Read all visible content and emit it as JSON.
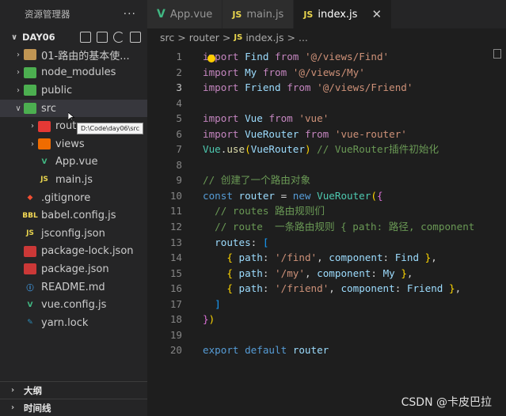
{
  "explorer": {
    "title": "资源管理器",
    "more": "···",
    "project": "DAY06",
    "project_chevron": "∨",
    "items": [
      {
        "label": "01-路由的基本使...",
        "arrow": "›",
        "type": "folder"
      },
      {
        "label": "node_modules",
        "arrow": "›",
        "type": "folder-green"
      },
      {
        "label": "public",
        "arrow": "›",
        "type": "folder-green"
      },
      {
        "label": "src",
        "arrow": "∨",
        "type": "folder-green"
      },
      {
        "label": "router",
        "arrow": "›",
        "type": "folder-red"
      },
      {
        "label": "views",
        "arrow": "›",
        "type": "folder-orange"
      },
      {
        "label": "App.vue",
        "arrow": "",
        "type": "vue"
      },
      {
        "label": "main.js",
        "arrow": "",
        "type": "js"
      },
      {
        "label": ".gitignore",
        "arrow": "",
        "type": "git"
      },
      {
        "label": "babel.config.js",
        "arrow": "",
        "type": "babel"
      },
      {
        "label": "jsconfig.json",
        "arrow": "",
        "type": "js"
      },
      {
        "label": "package-lock.json",
        "arrow": "",
        "type": "npm"
      },
      {
        "label": "package.json",
        "arrow": "",
        "type": "npm"
      },
      {
        "label": "README.md",
        "arrow": "",
        "type": "md"
      },
      {
        "label": "vue.config.js",
        "arrow": "",
        "type": "vue"
      },
      {
        "label": "yarn.lock",
        "arrow": "",
        "type": "yarn"
      }
    ],
    "tooltip": "D:\\Code\\day06\\src",
    "outline": "大纲",
    "timeline": "时间线"
  },
  "tabs": [
    {
      "label": "App.vue",
      "icon": "V",
      "kind": "vue"
    },
    {
      "label": "main.js",
      "icon": "JS",
      "kind": "js"
    },
    {
      "label": "index.js",
      "icon": "JS",
      "kind": "js",
      "active": true,
      "close": "✕"
    }
  ],
  "breadcrumb": [
    "src",
    "router",
    "index.js",
    "..."
  ],
  "breadcrumb_sep": ">",
  "code_lines": [
    {
      "n": "1",
      "tokens": [
        [
          "kw",
          "import"
        ],
        [
          "pl",
          " "
        ],
        [
          "var",
          "Find"
        ],
        [
          "pl",
          " "
        ],
        [
          "kw",
          "from"
        ],
        [
          "pl",
          " "
        ],
        [
          "str",
          "'@/views/Find'"
        ]
      ]
    },
    {
      "n": "2",
      "tokens": [
        [
          "kw",
          "import"
        ],
        [
          "pl",
          " "
        ],
        [
          "var",
          "My"
        ],
        [
          "pl",
          " "
        ],
        [
          "kw",
          "from"
        ],
        [
          "pl",
          " "
        ],
        [
          "str",
          "'@/views/My'"
        ]
      ]
    },
    {
      "n": "3",
      "tokens": [
        [
          "kw",
          "import"
        ],
        [
          "pl",
          " "
        ],
        [
          "var",
          "Friend"
        ],
        [
          "pl",
          " "
        ],
        [
          "kw",
          "from"
        ],
        [
          "pl",
          " "
        ],
        [
          "str",
          "'@/views/Friend'"
        ]
      ]
    },
    {
      "n": "4",
      "tokens": []
    },
    {
      "n": "5",
      "tokens": [
        [
          "kw",
          "import"
        ],
        [
          "pl",
          " "
        ],
        [
          "var",
          "Vue"
        ],
        [
          "pl",
          " "
        ],
        [
          "kw",
          "from"
        ],
        [
          "pl",
          " "
        ],
        [
          "str",
          "'vue'"
        ]
      ]
    },
    {
      "n": "6",
      "tokens": [
        [
          "kw",
          "import"
        ],
        [
          "pl",
          " "
        ],
        [
          "var",
          "VueRouter"
        ],
        [
          "pl",
          " "
        ],
        [
          "kw",
          "from"
        ],
        [
          "pl",
          " "
        ],
        [
          "str",
          "'vue-router'"
        ]
      ]
    },
    {
      "n": "7",
      "tokens": [
        [
          "cls",
          "Vue"
        ],
        [
          "pl",
          "."
        ],
        [
          "fn",
          "use"
        ],
        [
          "p1",
          "("
        ],
        [
          "var",
          "VueRouter"
        ],
        [
          "p1",
          ")"
        ],
        [
          "pl",
          " "
        ],
        [
          "cm",
          "// VueRouter插件初始化"
        ]
      ]
    },
    {
      "n": "8",
      "tokens": []
    },
    {
      "n": "9",
      "tokens": [
        [
          "cm",
          "// 创建了一个路由对象"
        ]
      ]
    },
    {
      "n": "10",
      "tokens": [
        [
          "kb",
          "const"
        ],
        [
          "pl",
          " "
        ],
        [
          "var",
          "router"
        ],
        [
          "pl",
          " = "
        ],
        [
          "kb",
          "new"
        ],
        [
          "pl",
          " "
        ],
        [
          "cls",
          "VueRouter"
        ],
        [
          "p1",
          "("
        ],
        [
          "p2",
          "{"
        ]
      ]
    },
    {
      "n": "11",
      "tokens": [
        [
          "pl",
          "  "
        ],
        [
          "cm",
          "// routes 路由规则们"
        ]
      ]
    },
    {
      "n": "12",
      "tokens": [
        [
          "pl",
          "  "
        ],
        [
          "cm",
          "// route  一条路由规则 { path: 路径, component"
        ]
      ]
    },
    {
      "n": "13",
      "tokens": [
        [
          "pl",
          "  "
        ],
        [
          "var",
          "routes"
        ],
        [
          "pl",
          ": "
        ],
        [
          "p3",
          "["
        ]
      ]
    },
    {
      "n": "14",
      "tokens": [
        [
          "pl",
          "    "
        ],
        [
          "p1",
          "{"
        ],
        [
          "pl",
          " "
        ],
        [
          "var",
          "path"
        ],
        [
          "pl",
          ": "
        ],
        [
          "str",
          "'/find'"
        ],
        [
          "pl",
          ", "
        ],
        [
          "var",
          "component"
        ],
        [
          "pl",
          ": "
        ],
        [
          "var",
          "Find"
        ],
        [
          "pl",
          " "
        ],
        [
          "p1",
          "}"
        ],
        [
          "pl",
          ","
        ]
      ]
    },
    {
      "n": "15",
      "tokens": [
        [
          "pl",
          "    "
        ],
        [
          "p1",
          "{"
        ],
        [
          "pl",
          " "
        ],
        [
          "var",
          "path"
        ],
        [
          "pl",
          ": "
        ],
        [
          "str",
          "'/my'"
        ],
        [
          "pl",
          ", "
        ],
        [
          "var",
          "component"
        ],
        [
          "pl",
          ": "
        ],
        [
          "var",
          "My"
        ],
        [
          "pl",
          " "
        ],
        [
          "p1",
          "}"
        ],
        [
          "pl",
          ","
        ]
      ]
    },
    {
      "n": "16",
      "tokens": [
        [
          "pl",
          "    "
        ],
        [
          "p1",
          "{"
        ],
        [
          "pl",
          " "
        ],
        [
          "var",
          "path"
        ],
        [
          "pl",
          ": "
        ],
        [
          "str",
          "'/friend'"
        ],
        [
          "pl",
          ", "
        ],
        [
          "var",
          "component"
        ],
        [
          "pl",
          ": "
        ],
        [
          "var",
          "Friend"
        ],
        [
          "pl",
          " "
        ],
        [
          "p1",
          "}"
        ],
        [
          "pl",
          ","
        ]
      ]
    },
    {
      "n": "17",
      "tokens": [
        [
          "pl",
          "  "
        ],
        [
          "p3",
          "]"
        ]
      ]
    },
    {
      "n": "18",
      "tokens": [
        [
          "p2",
          "}"
        ],
        [
          "p1",
          ")"
        ]
      ]
    },
    {
      "n": "19",
      "tokens": []
    },
    {
      "n": "20",
      "tokens": [
        [
          "kb",
          "export"
        ],
        [
          "pl",
          " "
        ],
        [
          "kb",
          "default"
        ],
        [
          "pl",
          " "
        ],
        [
          "var",
          "router"
        ]
      ]
    }
  ],
  "current_line": "3",
  "watermark": "CSDN @卡皮巴拉"
}
